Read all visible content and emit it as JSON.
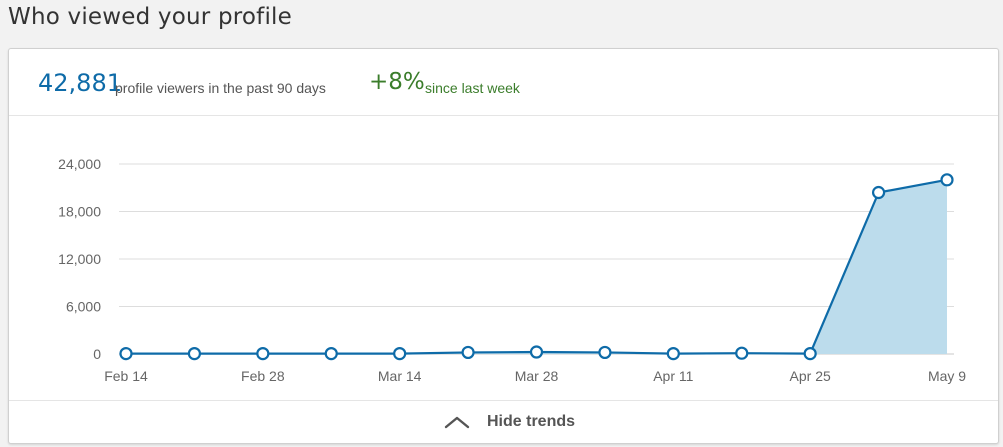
{
  "page": {
    "title": "Who viewed your profile"
  },
  "summary": {
    "count": "42,881",
    "count_text": "profile viewers in the past 90 days",
    "change": "+8%",
    "change_text": "since last week"
  },
  "footer": {
    "toggle_label": "Hide trends",
    "toggle_icon": "chevron-up-icon"
  },
  "colors": {
    "accent": "#0e6ba8",
    "positive": "#3b7d2b",
    "fill": "#bcdcec"
  },
  "chart_data": {
    "type": "area",
    "x": [
      "Feb 14",
      "Feb 21",
      "Feb 28",
      "Mar 7",
      "Mar 14",
      "Mar 21",
      "Mar 28",
      "Apr 4",
      "Apr 11",
      "Apr 18",
      "Apr 25",
      "May 2",
      "May 9"
    ],
    "x_tick_labels": [
      "Feb 14",
      "Feb 28",
      "Mar 14",
      "Mar 28",
      "Apr 11",
      "Apr 25",
      "May 9"
    ],
    "y_ticks": [
      "0",
      "6,000",
      "12,000",
      "18,000",
      "24,000"
    ],
    "ylim": [
      0,
      24000
    ],
    "series": [
      {
        "values": [
          50,
          50,
          50,
          50,
          50,
          200,
          250,
          200,
          50,
          100,
          50,
          20400,
          22000
        ]
      }
    ],
    "grid": true,
    "title": "",
    "xlabel": "",
    "ylabel": ""
  }
}
